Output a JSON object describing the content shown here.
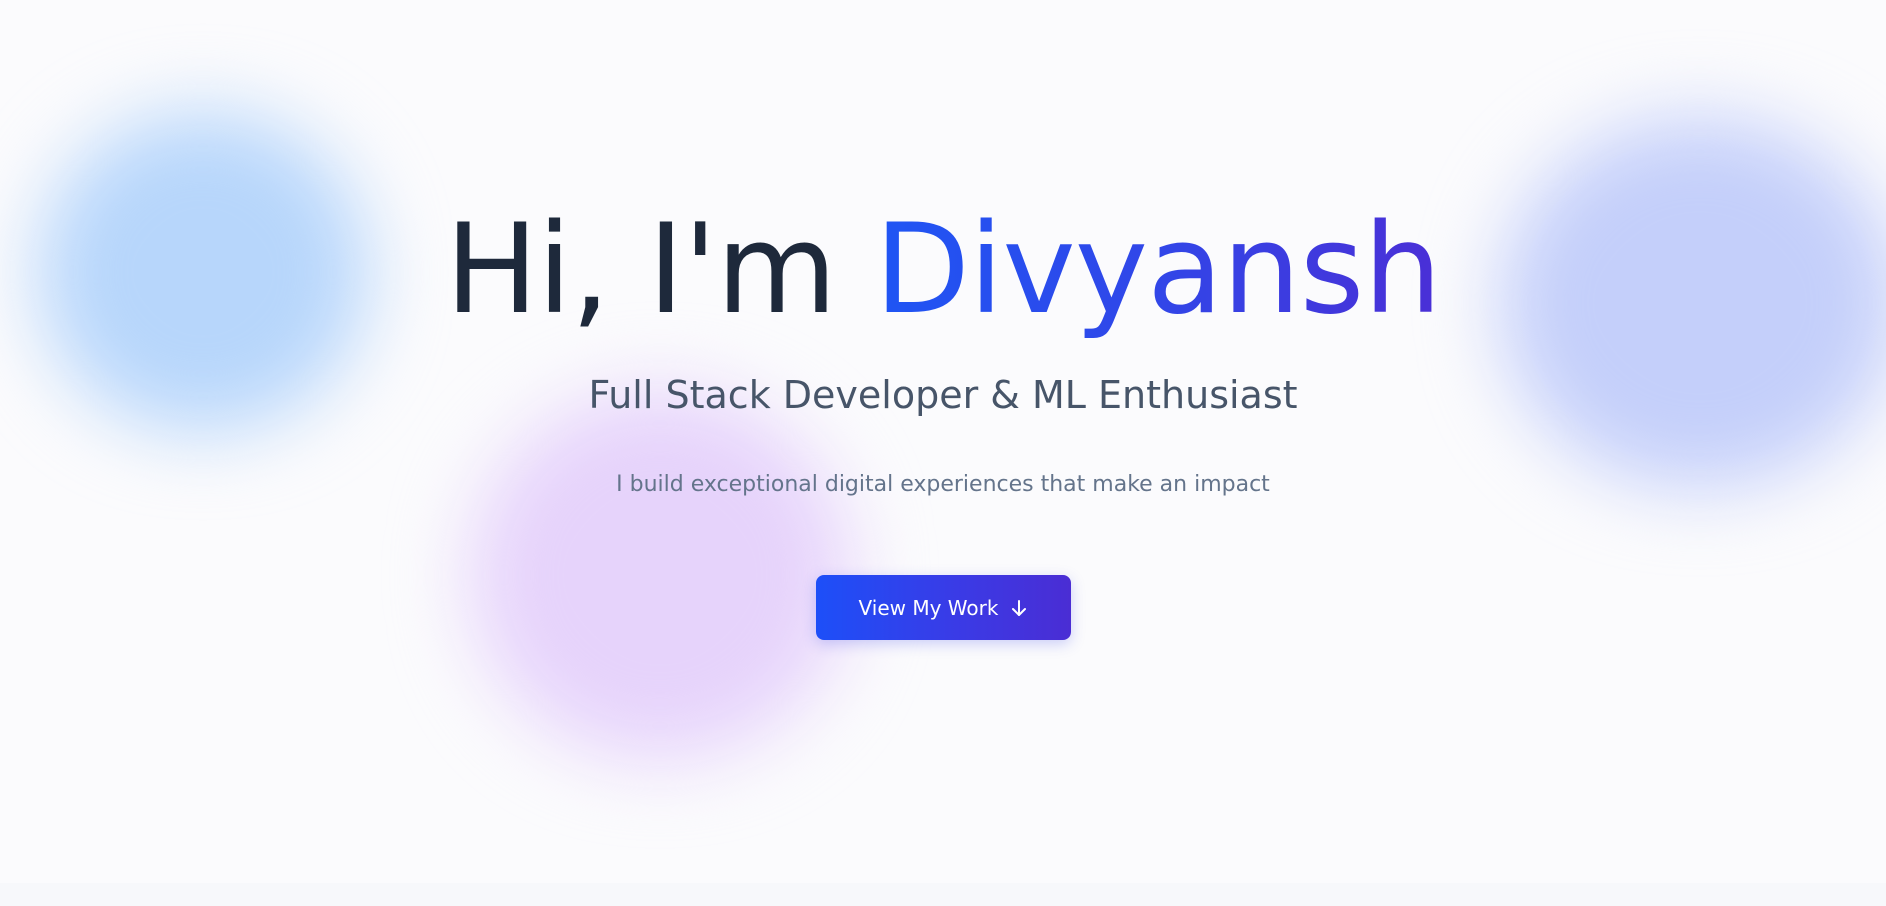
{
  "hero": {
    "greeting": "Hi, I'm ",
    "name": "Divyansh",
    "subtitle": "Full Stack Developer & ML Enthusiast",
    "tagline": "I build exceptional digital experiences that make an impact",
    "cta": {
      "label": "View My Work",
      "icon": "arrow-down-icon"
    }
  },
  "colors": {
    "heading_text": "#1e293b",
    "accent_gradient_start": "#1f55f4",
    "accent_gradient_end": "#4a2fd6",
    "subtitle_text": "#475569",
    "tagline_text": "#64748b",
    "blob_blue": "#b7d6fb",
    "blob_purple": "#e6d3fb",
    "blob_indigo": "#c4cffa"
  }
}
